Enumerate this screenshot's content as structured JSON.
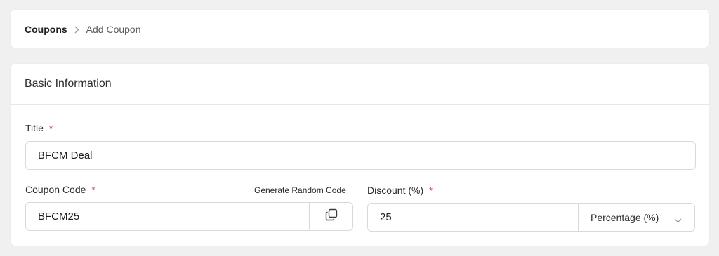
{
  "breadcrumb": {
    "root": "Coupons",
    "current": "Add Coupon"
  },
  "section": {
    "title": "Basic Information"
  },
  "fields": {
    "title": {
      "label": "Title",
      "required_mark": "*",
      "value": "BFCM Deal"
    },
    "coupon_code": {
      "label": "Coupon Code",
      "required_mark": "*",
      "generate_label": "Generate Random Code",
      "value": "BFCM25",
      "copy_icon": "copy-icon"
    },
    "discount": {
      "label": "Discount (%)",
      "required_mark": "*",
      "value": "25",
      "type_selected": "Percentage (%)",
      "dropdown_icon": "chevron-down-icon"
    }
  },
  "colors": {
    "background": "#f0f0f1",
    "card": "#ffffff",
    "required": "#d63638",
    "border": "#d9d9d9"
  }
}
